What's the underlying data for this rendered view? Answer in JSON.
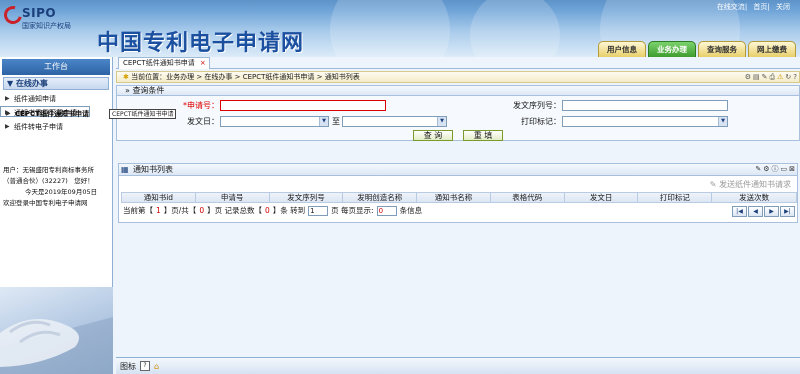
{
  "header": {
    "logo_brand": "SIPO",
    "logo_org": "国家知识产权局",
    "site_title": "中国专利电子申请网",
    "top_links": [
      "在线交流",
      "首页",
      "关闭"
    ],
    "main_tabs": [
      "用户信息",
      "业务办理",
      "查询服务",
      "网上缴费"
    ],
    "active_tab": "业务办理"
  },
  "sidebar": {
    "title": "工作台",
    "section": "在线办事",
    "items": [
      "纸件通知申请",
      "CEPCT纸件通知书申请",
      "通知书重复下载申请",
      "纸件转电子申请"
    ],
    "selected": 1,
    "user": [
      "用户：无锡盛阳专利商标事务所",
      "（普通合伙）(32227)　您好！",
      "今天是2019年09月05日",
      "欢迎登录中国专利电子申请网"
    ]
  },
  "page_tab": "CEPCT纸件通知书申请",
  "breadcrumb": "当前位置：业务办理 > 在线办事 > CEPCT纸件通知书申请 > 通知书列表",
  "query": {
    "title": "查询条件",
    "app_no_label": "*申请号：",
    "serial_label": "发文序列号：",
    "date_label": "发文日：",
    "to_label": "至",
    "print_label": "打印标记：",
    "search_btn": "查 询",
    "reset_btn": "重 填"
  },
  "tooltip": "CEPCT纸件通知书申请",
  "list": {
    "title": "通知书列表",
    "send_btn": "发送纸件通知书请求",
    "columns": [
      "通知书id",
      "申请号",
      "发文序列号",
      "发明创造名称",
      "通知书名称",
      "表格代码",
      "发文日",
      "打印标记",
      "发送次数"
    ]
  },
  "pager": {
    "p1": "当前第【",
    "cur": "1",
    "p2": "】页/共【",
    "total": "0",
    "p3": "】页  记录总数【",
    "count": "0",
    "p4": "】条 转到",
    "goto": "1",
    "p5": "页 每页显示:",
    "per": "0",
    "p6": "条信息"
  },
  "status": {
    "label": "图标"
  },
  "colors": {
    "accent": "#1b4fa0",
    "active_tab": "#3f9c2f",
    "required": "#d00000"
  }
}
